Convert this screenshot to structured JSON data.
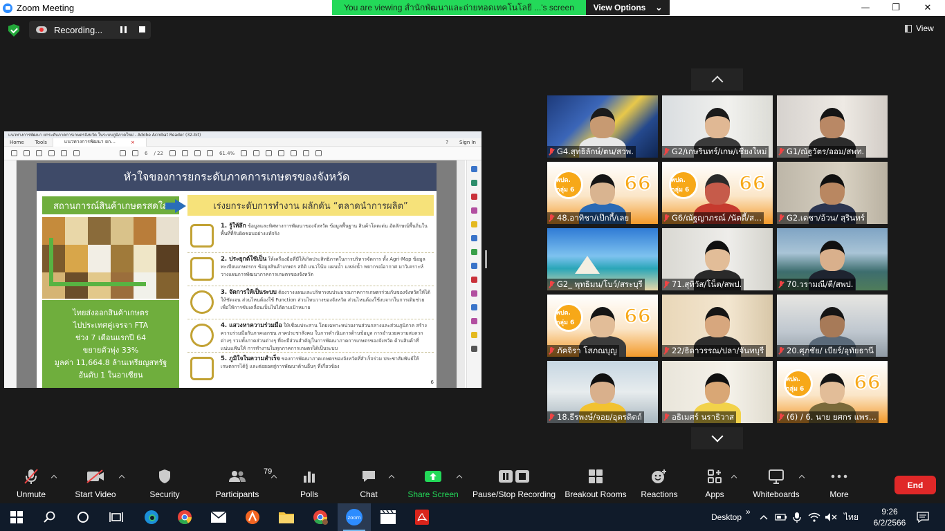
{
  "window": {
    "title": "Zoom Meeting",
    "minimize": "—",
    "restore": "❐",
    "close": "✕"
  },
  "banner": {
    "text": "You are viewing สำนักพัฒนาและถ่ายทอดเทคโนโลยี ...'s screen",
    "options_label": "View Options",
    "options_caret": "⌄"
  },
  "recording": {
    "label": "Recording..."
  },
  "view_button": "View",
  "acrobat": {
    "title": "แนวทางการพัฒนา ยกระดับภาคการเกษตรจังหวัด ในระบบภูมิภาคใหม่ - Adobe Acrobat Reader (32-bit)",
    "menu": [
      "Home",
      "Tools"
    ],
    "tab": "แนวทางการพัฒนา ยก...",
    "tab_close": "×",
    "help": "?",
    "sign_in": "Sign In",
    "page_current": "6",
    "page_total": "/ 22",
    "zoom": "61.4%"
  },
  "slide": {
    "title": "หัวใจของการยกระดับภาคการเกษตรของจังหวัด",
    "left_head": "สถานการณ์สินค้าเกษตรสดใส",
    "right_head": "เร่งยกระดับการทำงาน ผลักดัน “ตลาดนำการผลิต”",
    "left_lines": [
      "ไทยส่งออกสินค้าเกษตร",
      "ไปประเทศคู่เจรจา FTA",
      "ช่วง 7 เดือนแรกปี 64",
      "ขยายตัวพุ่ง 33%",
      "มูลค่า 11,664.8 ล้านเหรียญสหรัฐ",
      "อันดับ 1 ในอาเซียน"
    ],
    "items": [
      {
        "head": "1. รู้ให้ลึก",
        "body": "ข้อมูลและทิศทางการพัฒนาของจังหวัด ข้อมูลพื้นฐาน สินค้าโดดเด่น อัตลักษณ์พื้นถิ่นในพื้นที่ที่รับผิดชอบอย่างแท้จริง"
      },
      {
        "head": "2. ประยุกต์ใช้เป็น",
        "body": "ให้เครื่องมือที่มีให้เกิดประสิทธิภาพในการบริหารจัดการ ทั้ง Agri-Map ข้อมูลทะเบียนเกษตรกร ข้อมูลสินค้าเกษตร สถิติ แนวโน้ม แผนน้ำ แหล่งน้ำ พยากรณ์อากาศ มาวิเคราะห์วางแผนการพัฒนาภาคการเกษตรของจังหวัด"
      },
      {
        "head": "3. จัดการให้เป็นระบบ",
        "body": "ต้องวางแผนและบริหารงบประมาณภาคการเกษตรร่วมกันของจังหวัดให้ได้ ให้ชัดเจน ส่วนไหนต้องใช้ Function ส่วนไหนวางของจังหวัด ส่วนไหนต้องใช้งบจากในการเติมช่วย เพื่อให้การขับเคลื่อนเป็นไปได้ตามเป้าหมาย"
      },
      {
        "head": "4. แสวงหาความร่วมมือ",
        "body": "ให้เชื่อมประสาน โดยเฉพาะหน่วยงานส่วนกลางและส่วนภูมิภาค สร้างความร่วมมือกับภาคเอกชน ภาคประชาสังคม ในการดำเนินการด้านข้อมูล การอำนวยความสะดวกต่างๆ รวมทั้งภาคส่วนต่างๆ ที่จะมีส่วนสำคัญในการพัฒนาภาคการเกษตรของจังหวัด ด้านสินค้าที่แน่นแฟ้นให้ การทำงานในทุกภาคการเกษตรได้เป็นระบบ"
      },
      {
        "head": "5. ภูมิใจในความสำเร็จ",
        "body": "ของการพัฒนาภาคเกษตรของจังหวัดที่สำเร็จร่วม ประชาสัมพันธ์ให้เกษตรกรได้รู้ และต่อยอดสู่การพัฒนาด้านอื่นๆ ที่เกี่ยวข้อง"
      }
    ],
    "page_no": "6"
  },
  "gallery": {
    "badge_text": "พปด. กลุ่ม 6",
    "badge_year": "66",
    "tiles": [
      {
        "name": "G4.สุทธิลักษ์/ตน/สวพ.",
        "muted": true
      },
      {
        "name": "G2/เกษรินทร์/เกษ/เชียงใหม่",
        "muted": true
      },
      {
        "name": "G1/ณัฐวัตร/ออม/สพท.",
        "muted": true
      },
      {
        "name": "48.อาทิชา/เป๊กกี้/เลย",
        "muted": true
      },
      {
        "name": "G6/ณัฐญาภรณ์ /นัตตี้/ส...",
        "muted": true
      },
      {
        "name": "G2.เดชา/อ้วน/ สุรินทร์",
        "muted": true
      },
      {
        "name": "G2_ พุทธิมน/โบว์/สระบุรี",
        "muted": true
      },
      {
        "name": "71.สุทิวัส/โน็ต/สพป.",
        "muted": true
      },
      {
        "name": "70.วรามณี/ตี/สพป.",
        "muted": true
      },
      {
        "name": "ภัคจิรา โสภณบุญ",
        "muted": true
      },
      {
        "name": "22/ธิดาวรรณ/ปลา/จันทบุรี",
        "muted": true
      },
      {
        "name": "20.ศุภชัย/ เบียร์/อุทัยธานี",
        "muted": true
      },
      {
        "name": "18.ธีรพงษ์/จอย/อุตรดิตถ์",
        "muted": true
      },
      {
        "name": "อธิเมศร์ นราธิวาส",
        "muted": true
      },
      {
        "name": "(6) / 6. นาย ยศกร แพร...",
        "muted": true
      }
    ]
  },
  "toolbar": {
    "unmute": "Unmute",
    "start_video": "Start Video",
    "security": "Security",
    "participants": "Participants",
    "participants_count": "79",
    "polls": "Polls",
    "chat": "Chat",
    "share_screen": "Share Screen",
    "pause_stop_recording": "Pause/Stop Recording",
    "breakout_rooms": "Breakout Rooms",
    "reactions": "Reactions",
    "apps": "Apps",
    "whiteboards": "Whiteboards",
    "more": "More",
    "end": "End"
  },
  "taskbar": {
    "desktop": "Desktop",
    "chevrons": "»",
    "lang": "ไทย",
    "time": "9:26",
    "date": "6/2/2566"
  },
  "colors": {
    "share_green": "#23d959",
    "end_red": "#e02828",
    "zoom_blue": "#2d8cff",
    "muted_red": "#e44444"
  }
}
